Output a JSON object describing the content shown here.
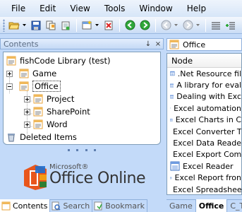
{
  "menu": [
    "File",
    "Edit",
    "View",
    "Tools",
    "Window",
    "Help"
  ],
  "toolbar": {
    "icons": [
      "open-folder-icon",
      "dropdown-arrow-icon",
      "save-icon",
      "copy-icon",
      "paste-icon",
      "new-item-icon",
      "dropdown-arrow-icon",
      "delete-icon",
      "back-icon",
      "forward-icon",
      "nav-disabled-icon",
      "nav-disabled-icon",
      "doc-icon",
      "doc-icon"
    ]
  },
  "left_pane": {
    "title": "Contents",
    "pin": "↓",
    "close": "×",
    "tree": {
      "root": "fishCode Library (test)",
      "game": "Game",
      "office": "Office",
      "project": "Project",
      "sharepoint": "SharePoint",
      "word": "Word",
      "deleted": "Deleted Items"
    },
    "logo": {
      "microsoft": "Microsoft®",
      "product": "Office Online"
    },
    "tabs": [
      "Contents",
      "Search",
      "Bookmark"
    ]
  },
  "right_pane": {
    "title": "Office",
    "column": "Node",
    "items": [
      ".Net Resource fil",
      "A library for eval",
      "Dealing with Exc",
      "Excel automation",
      "Excel Charts in C",
      "Excel Converter T",
      "Excel Data Reade",
      "Excel Export Com",
      "Excel Reader",
      "Excel Report fron",
      "Excel Spreadshee"
    ],
    "tabs": [
      "Game",
      "Office",
      "C_To"
    ]
  },
  "colors": {
    "chrome": "#c3daf9",
    "border": "#7f9db9",
    "accent": "#1f5fbf"
  }
}
